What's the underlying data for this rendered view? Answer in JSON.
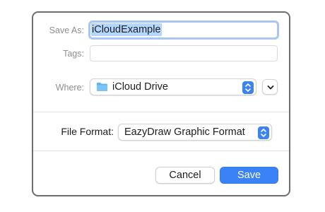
{
  "dialog": {
    "save_as_label": "Save As:",
    "filename_value": "iCloudExample",
    "tags_label": "Tags:",
    "tags_value": "",
    "where_label": "Where:",
    "where_value": "iCloud Drive",
    "file_format_label": "File Format:",
    "file_format_value": "EazyDraw Graphic Format",
    "cancel_label": "Cancel",
    "save_label": "Save"
  },
  "icons": {
    "folder": "folder-icon",
    "popup_stepper": "up-down-chevrons-icon",
    "expand": "chevron-down-icon"
  },
  "colors": {
    "accent": "#3b82f6",
    "selection": "#b3d7ff",
    "focus_ring": "#a9c6f2",
    "folder": "#5ab0f0"
  }
}
